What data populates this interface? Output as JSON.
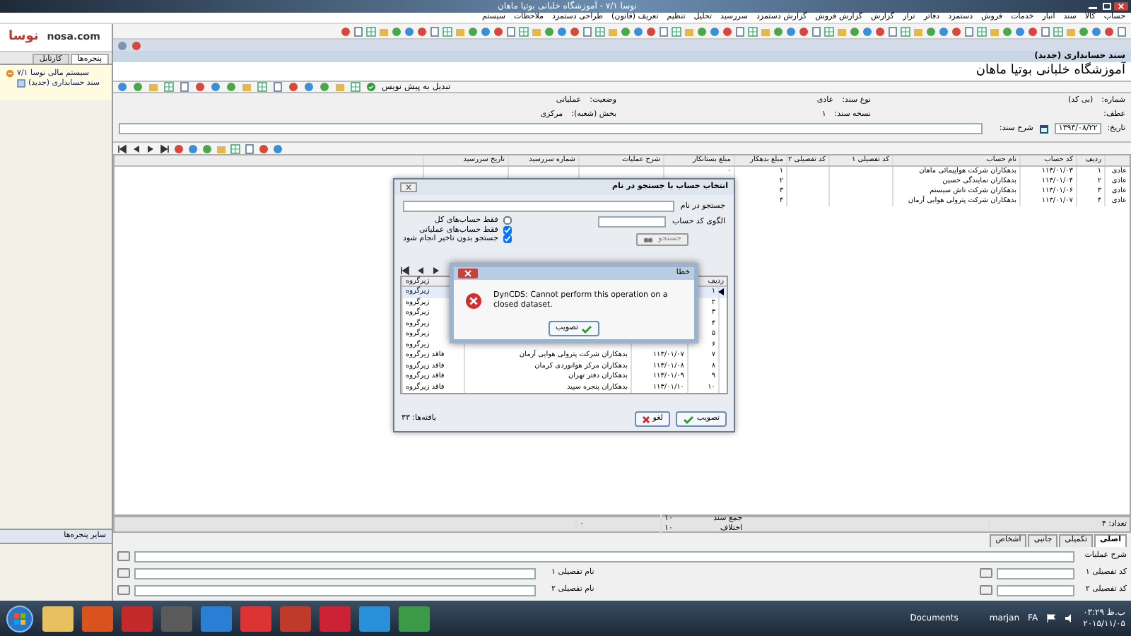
{
  "window": {
    "title": "نوسا ۷/۱ - آموزشگاه خلبانی بوتیا ماهان"
  },
  "menu": [
    "حساب",
    "کالا",
    "سند",
    "انبار",
    "خدمات",
    "فروش",
    "دستمزد",
    "دفاتر",
    "تراز",
    "گزارش",
    "گزارش فروش",
    "گزارش دستمزد",
    "سررسید",
    "تحلیل",
    "تنظیم",
    "تعریف (قانون)",
    "طراحی دستمزد",
    "ملاحظات",
    "سیستم"
  ],
  "sidebar": {
    "logo_mark": "نوسا",
    "logo_site": "nosa.com",
    "tabs": [
      {
        "label": "پنجره‌ها",
        "selected": true
      },
      {
        "label": "کارتابل",
        "selected": false
      }
    ],
    "tree": [
      {
        "label": "سیستم مالی نوسا ۷/۱",
        "expanded": true,
        "children": [
          {
            "label": "سند حسابداری (جدید)"
          }
        ]
      }
    ],
    "footer": "سایر پنجره‌ها"
  },
  "document": {
    "header": "سند حسابداری (جدید)",
    "company": "آموزشگاه خلبانی بوتیا ماهان",
    "toolbar_text": "تبدیل به پیش نویس",
    "fields_row1": [
      {
        "label": "شماره:",
        "value": "(بی کد)"
      },
      {
        "label": "نوع سند:",
        "value": "عادی"
      },
      {
        "label": "وضعیت:",
        "value": "عملیاتی"
      }
    ],
    "fields_row2": [
      {
        "label": "عطف:"
      },
      {
        "label": "نسخه سند:",
        "value": "۱"
      },
      {
        "label": "بخش (شعبه):",
        "value": "مرکزی"
      }
    ],
    "date": {
      "label": "تاریخ:",
      "value": "۱۳۹۴/۰۸/۲۲"
    },
    "description": {
      "label": "شرح سند:"
    },
    "grid": {
      "columns": [
        "ردیف",
        "کد حساب",
        "نام حساب",
        "کد تفصیلی ۱",
        "کد تفصیلی ۲",
        "مبلغ بدهکار",
        "مبلغ بستانکار",
        "شرح عملیات",
        "شماره سررسید",
        "تاریخ سررسید"
      ],
      "rows": [
        {
          "type": "عادی",
          "cells": [
            "۱",
            "۱۱۳/۰۱/۰۳",
            "بدهکاران شرکت هواپیمائی ماهان",
            "",
            "",
            "۱",
            "۰",
            "",
            "",
            ""
          ]
        },
        {
          "type": "عادی",
          "cells": [
            "۲",
            "۱۱۳/۰۱/۰۴",
            "بدهکاران نمایندگی حسین",
            "",
            "",
            "۲",
            "",
            "",
            "",
            ""
          ]
        },
        {
          "type": "عادی",
          "cells": [
            "۳",
            "۱۱۳/۰۱/۰۶",
            "بدهکاران شرکت تاش سیستم",
            "",
            "",
            "۳",
            "",
            "",
            "",
            ""
          ]
        },
        {
          "type": "عادی",
          "cells": [
            "۴",
            "۱۱۳/۰۱/۰۷",
            "بدهکاران شرکت پترولی هوایی آرمان",
            "",
            "",
            "۴",
            "",
            "",
            "",
            ""
          ]
        }
      ],
      "footer": {
        "count": "تعداد: ۴",
        "sum_label": "جمع سند",
        "sum": "۱۰",
        "diff_label": "اختلاف",
        "diff": "۱۰",
        "credit_sum": "۰"
      }
    },
    "detail_tabs": [
      {
        "label": "اصلی",
        "selected": true
      },
      {
        "label": "تکمیلی",
        "selected": false
      },
      {
        "label": "جانبی",
        "selected": false
      },
      {
        "label": "اشخاص",
        "selected": false
      }
    ],
    "detail_fields": [
      {
        "kind": "wide",
        "label": "شرح عملیات"
      },
      {
        "kind": "pair",
        "label": "کد تفصیلی ۱",
        "label2": "نام تفصیلی ۱"
      },
      {
        "kind": "pair",
        "label": "کد تفصیلی ۲",
        "label2": "نام تفصیلی ۲"
      }
    ]
  },
  "search_dialog": {
    "title": "انتخاب حساب با جستجو در نام",
    "name_label": "جستجو در نام",
    "code_label": "الگوی کد حساب",
    "checkboxes": [
      {
        "label": "فقط حساب‌های کل",
        "checked": false
      },
      {
        "label": "فقط حساب‌های عملیاتی",
        "checked": true
      },
      {
        "label": "جستجو بدون تاخیر انجام شود",
        "checked": true
      }
    ],
    "search_button": {
      "label": "جستجو",
      "disabled": true
    },
    "columns": [
      "ردیف",
      "زیرگروه"
    ],
    "rows": [
      {
        "row": "۱",
        "sub": "زیرگروه",
        "selected": true
      },
      {
        "row": "۲",
        "sub": "زیرگروه",
        "selected": false
      },
      {
        "row": "۳",
        "sub": "زیرگروه",
        "selected": false
      },
      {
        "row": "۴",
        "sub": "زیرگروه",
        "selected": false
      },
      {
        "row": "۵",
        "sub": "زیرگروه",
        "selected": false
      },
      {
        "row": "۶",
        "sub": "زیرگروه",
        "selected": false
      },
      {
        "row": "۷",
        "code": "۱۱۳/۰۱/۰۷",
        "name": "بدهکاران شرکت پترولی هوایی آرمان",
        "sub": "فاقد زیرگروه",
        "selected": false
      },
      {
        "row": "۸",
        "code": "۱۱۳/۰۱/۰۸",
        "name": "بدهکاران مرکز هوانوردی کرمان",
        "sub": "فاقد زیرگروه",
        "selected": false
      },
      {
        "row": "۹",
        "code": "۱۱۳/۰۱/۰۹",
        "name": "بدهکاران دفتر تهران",
        "sub": "فاقد زیرگروه",
        "selected": false
      },
      {
        "row": "۱۰",
        "code": "۱۱۳/۰۱/۱۰",
        "name": "بدهکاران پنجره سپید",
        "sub": "فاقد زیرگروه",
        "selected": false
      }
    ],
    "ok": "تصویب",
    "cancel": "لغو",
    "found": "یافته‌ها: ۳۳"
  },
  "error_dialog": {
    "title": "خطا",
    "message": "DynCDS: Cannot perform this operation on a closed dataset.",
    "ok": "تصویب"
  },
  "taskbar": {
    "toolbar_label": "Documents",
    "user": "marjan",
    "language": "FA",
    "time": "۰۳:۲۹ ب.ظ",
    "date": "۲۰۱۵/۱۱/۰۵"
  }
}
